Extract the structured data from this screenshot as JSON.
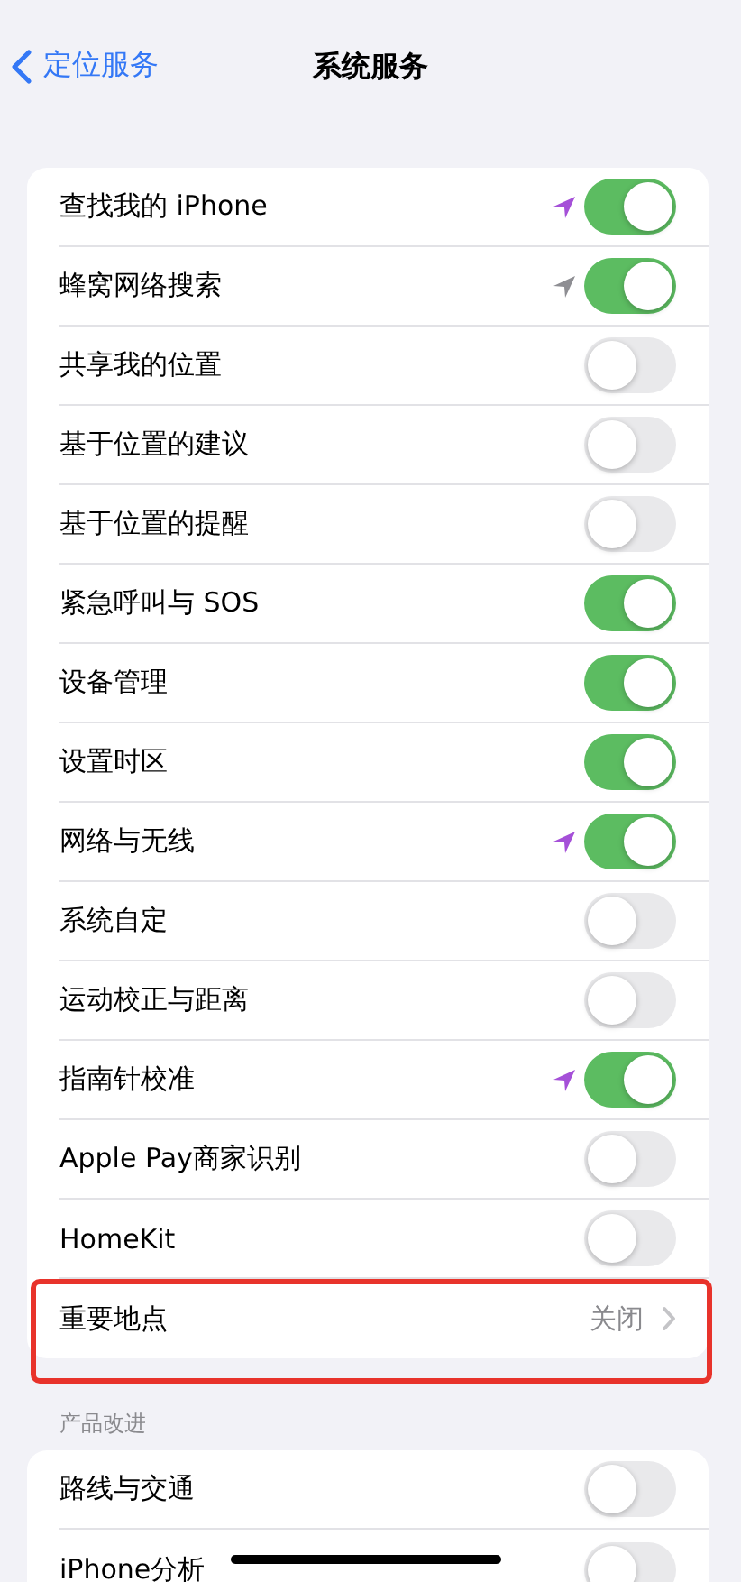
{
  "nav": {
    "back_label": "定位服务",
    "title": "系统服务"
  },
  "groups": [
    {
      "rows": [
        {
          "label": "查找我的 iPhone",
          "kind": "toggle",
          "on": true,
          "location_arrow": {
            "color": "#a550d8"
          }
        },
        {
          "label": "蜂窝网络搜索",
          "kind": "toggle",
          "on": true,
          "location_arrow": {
            "color": "#8e8e93"
          }
        },
        {
          "label": "共享我的位置",
          "kind": "toggle",
          "on": false
        },
        {
          "label": "基于位置的建议",
          "kind": "toggle",
          "on": false
        },
        {
          "label": "基于位置的提醒",
          "kind": "toggle",
          "on": false
        },
        {
          "label": "紧急呼叫与 SOS",
          "kind": "toggle",
          "on": true
        },
        {
          "label": "设备管理",
          "kind": "toggle",
          "on": true
        },
        {
          "label": "设置时区",
          "kind": "toggle",
          "on": true
        },
        {
          "label": "网络与无线",
          "kind": "toggle",
          "on": true,
          "location_arrow": {
            "color": "#a550d8"
          }
        },
        {
          "label": "系统自定",
          "kind": "toggle",
          "on": false
        },
        {
          "label": "运动校正与距离",
          "kind": "toggle",
          "on": false
        },
        {
          "label": "指南针校准",
          "kind": "toggle",
          "on": true,
          "location_arrow": {
            "color": "#a550d8"
          }
        },
        {
          "label": "Apple Pay商家识别",
          "kind": "toggle",
          "on": false
        },
        {
          "label": "HomeKit",
          "kind": "toggle",
          "on": false
        },
        {
          "label": "重要地点",
          "kind": "link",
          "value": "关闭",
          "highlighted": true
        }
      ]
    },
    {
      "header": "产品改进",
      "rows": [
        {
          "label": "路线与交通",
          "kind": "toggle",
          "on": false
        },
        {
          "label": "iPhone分析",
          "kind": "toggle",
          "on": false
        }
      ]
    }
  ]
}
